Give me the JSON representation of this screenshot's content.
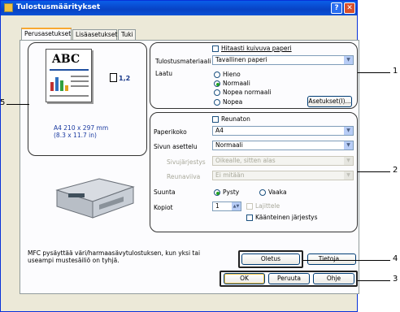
{
  "window": {
    "title": "Tulostusmääritykset",
    "help_glyph": "?",
    "close_glyph": "✕"
  },
  "tabs": [
    {
      "label": "Perusasetukset",
      "active": true
    },
    {
      "label": "Lisäasetukset",
      "active": false
    },
    {
      "label": "Tuki",
      "active": false
    }
  ],
  "preview": {
    "abc_text": "ABC",
    "copies_badge": "1,2",
    "paper_size": "A4 210 x 297 mm",
    "paper_size_in": "(8.3 x 11.7 in)"
  },
  "media": {
    "slow_drying_label": "Hitaasti kuivuva paperi",
    "media_label": "Tulostusmateriaali",
    "media_value": "Tavallinen paperi",
    "quality_label": "Laatu",
    "quality_options": [
      "Hieno",
      "Normaali",
      "Nopea normaali",
      "Nopea"
    ],
    "quality_selected": "Normaali",
    "settings_button": "Asetukset(I)..."
  },
  "layout": {
    "borderless_label": "Reunaton",
    "paper_size_label": "Paperikoko",
    "paper_size_value": "A4",
    "page_layout_label": "Sivun asettelu",
    "page_layout_value": "Normaali",
    "page_order_label": "Sivujärjestys",
    "page_order_value": "Oikealle, sitten alas",
    "border_line_label": "Reunaviiva",
    "border_line_value": "Ei mitään",
    "orientation_label": "Suunta",
    "portrait_label": "Pysty",
    "landscape_label": "Vaaka",
    "orientation_selected": "Pysty",
    "copies_label": "Kopiot",
    "copies_value": "1",
    "collate_label": "Lajittele",
    "reverse_label": "Käänteinen järjestys"
  },
  "footer": {
    "message": "MFC pysäyttää väri/harmaasävytulostuksen, kun yksi tai useampi mustesäiliö on tyhjä.",
    "default_button": "Oletus",
    "info_button": "Tietoja...",
    "ok_button": "OK",
    "cancel_button": "Peruuta",
    "help_button": "Ohje"
  },
  "callouts": {
    "c1": "1",
    "c2": "2",
    "c3": "3",
    "c4": "4",
    "c5": "5"
  }
}
